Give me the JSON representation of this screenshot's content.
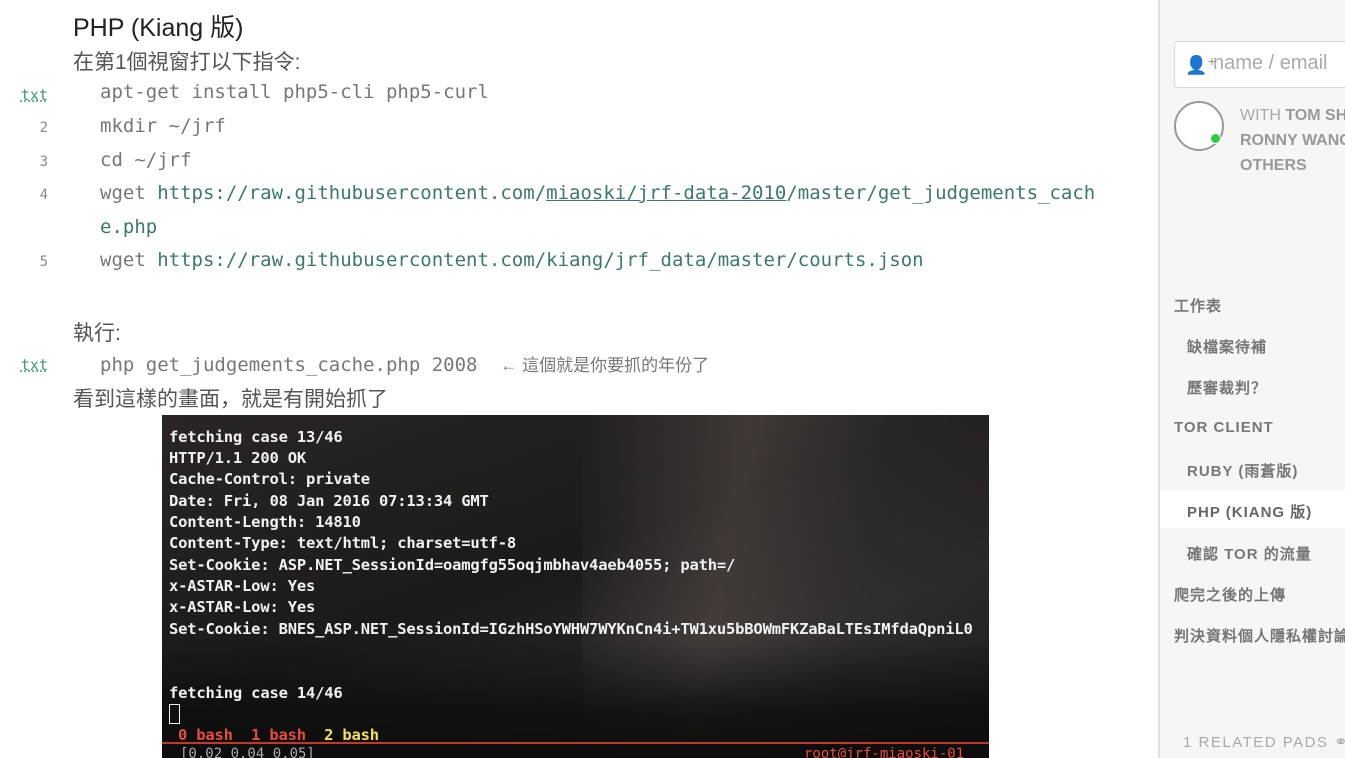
{
  "doc": {
    "heading": "PHP (Kiang 版)",
    "intro": "在第1個視窗打以下指令:",
    "code_block_1": {
      "lang_label": "txt",
      "lines": [
        {
          "num": "txt",
          "text": "apt-get install php5-cli php5-curl"
        },
        {
          "num": "2",
          "text": "mkdir ~/jrf"
        },
        {
          "num": "3",
          "text": "cd ~/jrf"
        },
        {
          "num": "4",
          "prefix": "wget ",
          "url_a": "https://raw.githubusercontent.com/",
          "url_b": "miaoski/jrf-data-2010",
          "url_c": "/master/get_judgements_cach"
        },
        {
          "num": "",
          "text_url": "e.php"
        },
        {
          "num": "5",
          "prefix": "wget ",
          "url": "https://raw.githubusercontent.com/kiang/jrf_data/master/courts.json"
        }
      ]
    },
    "exec_label": "執行:",
    "code_block_2": {
      "num": "txt",
      "text": "php get_judgements_cache.php 2008",
      "note": "← 這個就是你要抓的年份了"
    },
    "outro": "看到這樣的畫面，就是有開始抓了",
    "terminal": {
      "lines": [
        "fetching case 13/46",
        "HTTP/1.1 200 OK",
        "Cache-Control: private",
        "Date: Fri, 08 Jan 2016 07:13:34 GMT",
        "Content-Length: 14810",
        "Content-Type: text/html; charset=utf-8",
        "Set-Cookie: ASP.NET_SessionId=oamgfg55oqjmbhav4aeb4055; path=/",
        "x-ASTAR-Low: Yes",
        "x-ASTAR-Low: Yes",
        "Set-Cookie: BNES_ASP.NET_SessionId=IGzhHSoYWHW7WYKnCn4i+TW1xu5bBOWmFKZaBaLTEsIMfdaQpniL0"
      ],
      "line2": "fetching case 14/46",
      "tab0": "0 bash",
      "tab1": "1 bash",
      "tab2": "2 bash",
      "status_left": "[0.02 0.04 0.05]",
      "status_right": "root@jrf-miaoski-01"
    }
  },
  "sidebar": {
    "search_placeholder": "name / email",
    "with_prefix": "WITH",
    "with_names_1": "TOM SH",
    "with_names_2": "RONNY WANG",
    "with_names_3": "OTHERS",
    "toc": [
      "工作表",
      "缺檔案待補",
      "歷審裁判？",
      "TOR CLIENT",
      "RUBY (雨蒼版)",
      "PHP (KIANG 版)",
      "確認 TOR 的流量",
      "爬完之後的上傳",
      "判決資料個人隱私權討論"
    ],
    "related": "1 RELATED PADS"
  }
}
